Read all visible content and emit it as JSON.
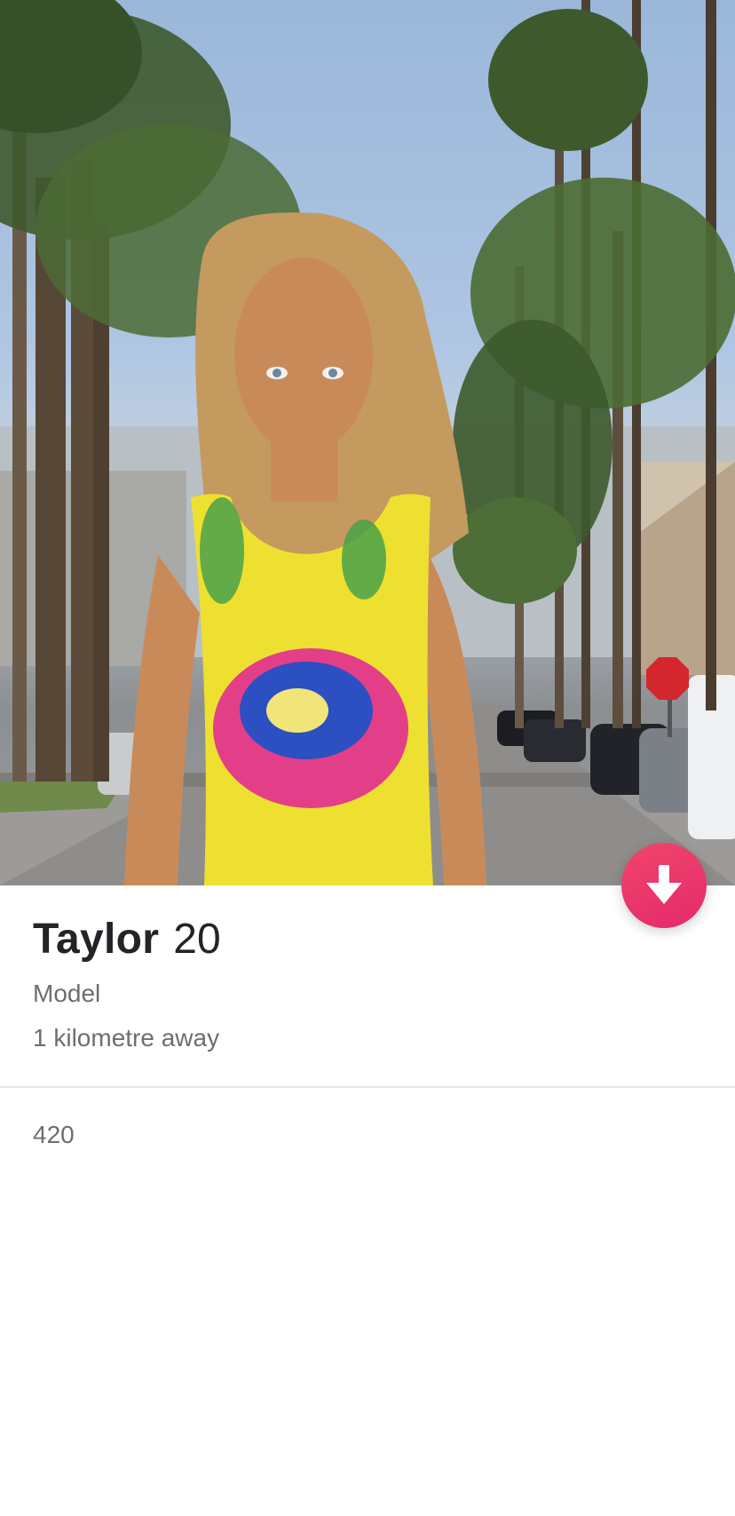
{
  "profile": {
    "name": "Taylor",
    "age": "20",
    "job": "Model",
    "distance": "1 kilometre away",
    "bio": "420",
    "photo_icon": "profile-photo"
  },
  "actions": {
    "collapse_icon": "arrow-down-icon",
    "accent": "#e8316b"
  }
}
